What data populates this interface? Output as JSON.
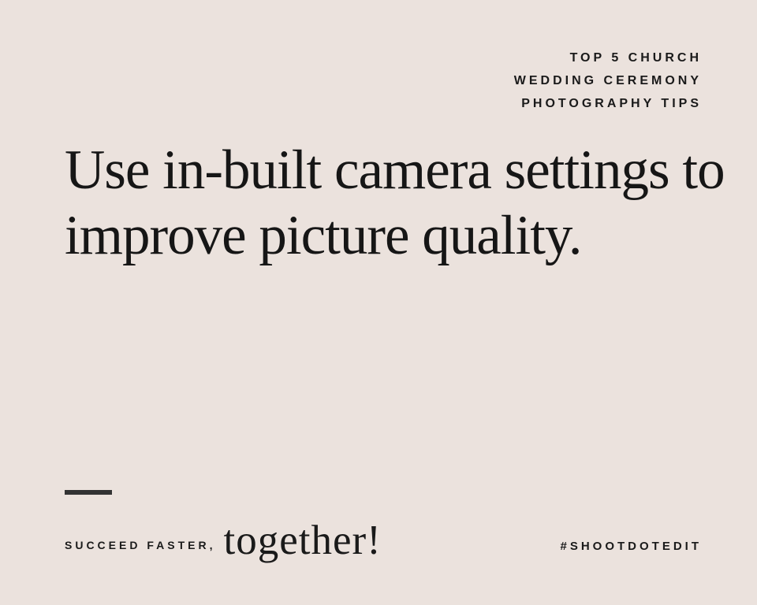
{
  "header": {
    "line1": "TOP 5 CHURCH",
    "line2": "WEDDING CEREMONY",
    "line3": "PHOTOGRAPHY TIPS"
  },
  "headline": "Use in-built camera settings to improve picture quality.",
  "tagline": {
    "plain": "SUCCEED FASTER,",
    "script": "together!"
  },
  "hashtag": "#SHOOTDOTEDIT"
}
